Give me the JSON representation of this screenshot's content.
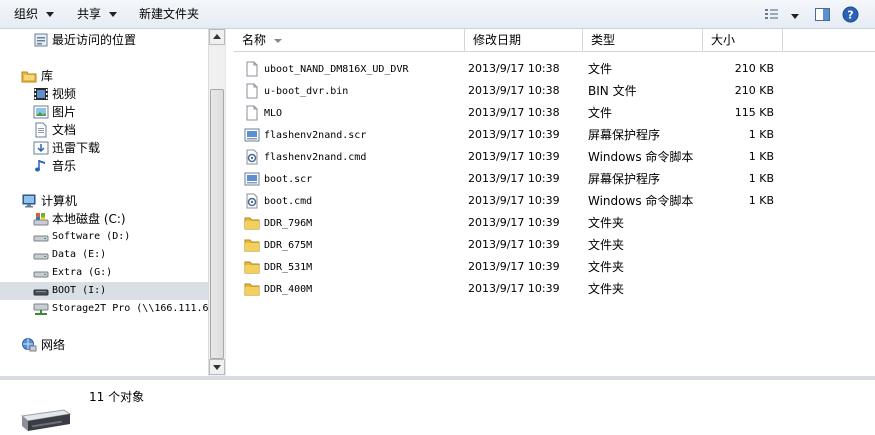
{
  "toolbar": {
    "organize": "组织",
    "share": "共享",
    "new_folder": "新建文件夹"
  },
  "nav": {
    "items": [
      {
        "label": "最近访问的位置",
        "icon": "recent-places-icon"
      },
      {
        "label": "库",
        "icon": "library-icon"
      },
      {
        "label": "视频",
        "icon": "video-icon"
      },
      {
        "label": "图片",
        "icon": "pictures-icon"
      },
      {
        "label": "文档",
        "icon": "documents-icon"
      },
      {
        "label": "迅雷下载",
        "icon": "xunlei-download-icon"
      },
      {
        "label": "音乐",
        "icon": "music-icon"
      },
      {
        "label": "计算机",
        "icon": "computer-icon"
      },
      {
        "label": "本地磁盘 (C:)",
        "icon": "system-drive-icon"
      },
      {
        "label": "Software (D:)",
        "icon": "drive-icon"
      },
      {
        "label": "Data (E:)",
        "icon": "drive-icon"
      },
      {
        "label": "Extra (G:)",
        "icon": "drive-icon"
      },
      {
        "label": "BOOT (I:)",
        "icon": "removable-drive-icon",
        "selected": true
      },
      {
        "label": "Storage2T Pro (\\\\166.111.6",
        "icon": "network-drive-icon"
      },
      {
        "label": "网络",
        "icon": "network-icon"
      }
    ]
  },
  "columns": {
    "name": "名称",
    "date": "修改日期",
    "type": "类型",
    "size": "大小"
  },
  "files": [
    {
      "name": "uboot_NAND_DM816X_UD_DVR",
      "date": "2013/9/17 10:38",
      "type": "文件",
      "size": "210 KB",
      "icon": "file-icon"
    },
    {
      "name": "u-boot_dvr.bin",
      "date": "2013/9/17 10:38",
      "type": "BIN 文件",
      "size": "210 KB",
      "icon": "file-icon"
    },
    {
      "name": "MLO",
      "date": "2013/9/17 10:38",
      "type": "文件",
      "size": "115 KB",
      "icon": "file-icon"
    },
    {
      "name": "flashenv2nand.scr",
      "date": "2013/9/17 10:39",
      "type": "屏幕保护程序",
      "size": "1 KB",
      "icon": "screensaver-icon"
    },
    {
      "name": "flashenv2nand.cmd",
      "date": "2013/9/17 10:39",
      "type": "Windows 命令脚本",
      "size": "1 KB",
      "icon": "cmd-script-icon"
    },
    {
      "name": "boot.scr",
      "date": "2013/9/17 10:39",
      "type": "屏幕保护程序",
      "size": "1 KB",
      "icon": "screensaver-icon"
    },
    {
      "name": "boot.cmd",
      "date": "2013/9/17 10:39",
      "type": "Windows 命令脚本",
      "size": "1 KB",
      "icon": "cmd-script-icon"
    },
    {
      "name": "DDR_796M",
      "date": "2013/9/17 10:39",
      "type": "文件夹",
      "size": "",
      "icon": "folder-icon"
    },
    {
      "name": "DDR_675M",
      "date": "2013/9/17 10:39",
      "type": "文件夹",
      "size": "",
      "icon": "folder-icon"
    },
    {
      "name": "DDR_531M",
      "date": "2013/9/17 10:39",
      "type": "文件夹",
      "size": "",
      "icon": "folder-icon"
    },
    {
      "name": "DDR_400M",
      "date": "2013/9/17 10:39",
      "type": "文件夹",
      "size": "",
      "icon": "folder-icon"
    }
  ],
  "details": {
    "count": "11 个对象"
  },
  "colors": {
    "toolbar_bg": "#e6ecf4",
    "selected_bg": "#dadfe6",
    "folder": "#e8b93c",
    "help": "#2a62b8"
  }
}
